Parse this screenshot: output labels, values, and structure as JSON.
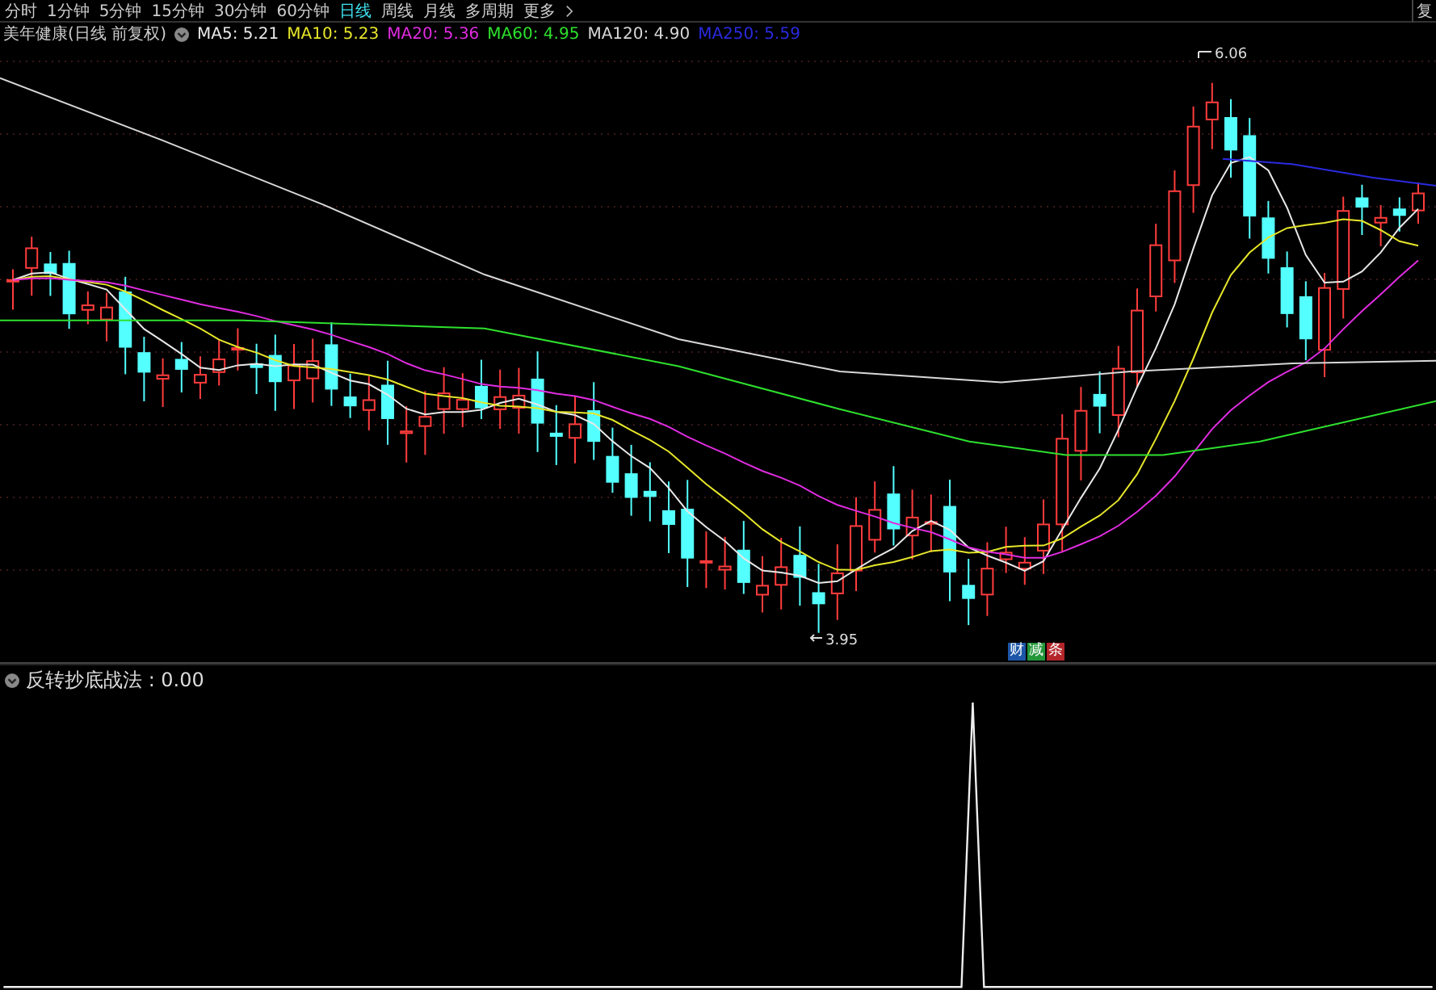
{
  "toolbar": {
    "periods": [
      {
        "label": "分时",
        "selected": false
      },
      {
        "label": "1分钟",
        "selected": false
      },
      {
        "label": "5分钟",
        "selected": false
      },
      {
        "label": "15分钟",
        "selected": false
      },
      {
        "label": "30分钟",
        "selected": false
      },
      {
        "label": "60分钟",
        "selected": false
      },
      {
        "label": "日线",
        "selected": true
      },
      {
        "label": "周线",
        "selected": false
      },
      {
        "label": "月线",
        "selected": false
      },
      {
        "label": "多周期",
        "selected": false
      }
    ],
    "more": "更多",
    "right_label": "复"
  },
  "legend": {
    "title": "美年健康(日线 前复权)",
    "items": [
      {
        "label": "MA5: 5.21",
        "color": "#e8e8e8"
      },
      {
        "label": "MA10: 5.23",
        "color": "#e6e62a"
      },
      {
        "label": "MA20: 5.36",
        "color": "#e02ce0"
      },
      {
        "label": "MA60: 4.95",
        "color": "#2ee02e"
      },
      {
        "label": "MA120: 4.90",
        "color": "#d8d8d8"
      },
      {
        "label": "MA250: 5.59",
        "color": "#2a2ae0"
      }
    ]
  },
  "price_chart": {
    "high_label": "6.06",
    "low_label": "3.95",
    "badges": [
      {
        "label": "财",
        "color": "#1d56a8"
      },
      {
        "label": "减",
        "color": "#24963a"
      },
      {
        "label": "条",
        "color": "#b3262a"
      }
    ]
  },
  "indicator": {
    "label": "反转抄底战法 : 0.00"
  }
}
